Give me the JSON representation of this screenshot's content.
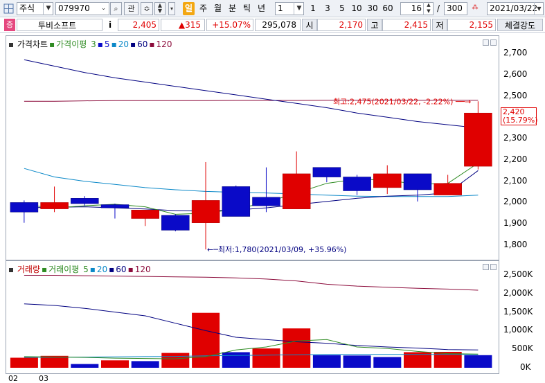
{
  "toolbar": {
    "market": "주식",
    "code": "079970",
    "buttons": [
      "관"
    ],
    "periods": [
      "일",
      "주",
      "월",
      "분",
      "틱",
      "년"
    ],
    "selected_period": "일",
    "interval": "1",
    "intervals": [
      "1",
      "3",
      "5",
      "10",
      "30",
      "60"
    ],
    "count": "16",
    "count_sep": "/",
    "total": "300",
    "date": "2021/03/22"
  },
  "quote": {
    "badge": "증",
    "name": "투비소프트",
    "info": "i",
    "price": "2,405",
    "change": "▲315",
    "change_pct": "+15.07%",
    "volume": "295,078",
    "open_label": "시",
    "open": "2,170",
    "high_label": "고",
    "high": "2,415",
    "low_label": "저",
    "low": "2,155",
    "strength": "체결강도"
  },
  "price_panel": {
    "legend": [
      {
        "text": "가격차트",
        "color": "#000000"
      },
      {
        "text": "가격이평",
        "color": "#2e8b22"
      },
      {
        "text": "3",
        "color": "#2e8b22"
      },
      {
        "text": "5",
        "color": "#0a0ac8"
      },
      {
        "text": "20",
        "color": "#0a88c8"
      },
      {
        "text": "60",
        "color": "#000080"
      },
      {
        "text": "120",
        "color": "#8b0a3a"
      }
    ],
    "high_annotation": "최고:2,475(2021/03/22, -2.22%)",
    "low_annotation": "최저:1,780(2021/03/09, +35.96%)",
    "current_price": "2,420",
    "current_pct": "(15.79%)",
    "yticks": [
      "2,700",
      "2,600",
      "2,500",
      "2,400",
      "2,300",
      "2,200",
      "2,100",
      "2,000",
      "1,900",
      "1,800"
    ]
  },
  "volume_panel": {
    "legend": [
      {
        "text": "거래량",
        "color": "#c00000"
      },
      {
        "text": "거래이평",
        "color": "#2e8b22"
      },
      {
        "text": "5",
        "color": "#2e8b22"
      },
      {
        "text": "20",
        "color": "#0a88c8"
      },
      {
        "text": "60",
        "color": "#000080"
      },
      {
        "text": "120",
        "color": "#8b0a3a"
      }
    ],
    "yticks": [
      "2,500K",
      "2,000K",
      "1,500K",
      "1,000K",
      "500K",
      "0K"
    ]
  },
  "xaxis": {
    "labels": [
      "02",
      "03"
    ]
  },
  "colors": {
    "up": "#e00000",
    "down": "#0a0ac8",
    "ma3": "#2e8b22",
    "ma20": "#0a88c8",
    "ma60": "#000080",
    "ma120": "#8b0a3a"
  },
  "chart_data": [
    {
      "type": "candlestick",
      "title": "가격차트",
      "ylim": [
        1720,
        2780
      ],
      "candles": [
        {
          "open": 2000,
          "high": 2010,
          "low": 1905,
          "close": 1955
        },
        {
          "open": 1970,
          "high": 2075,
          "low": 1955,
          "close": 2000
        },
        {
          "open": 2020,
          "high": 2030,
          "low": 1985,
          "close": 1995
        },
        {
          "open": 1990,
          "high": 1995,
          "low": 1925,
          "close": 1975
        },
        {
          "open": 1925,
          "high": 1965,
          "low": 1890,
          "close": 1965
        },
        {
          "open": 1940,
          "high": 1945,
          "low": 1865,
          "close": 1870
        },
        {
          "open": 1905,
          "high": 2190,
          "low": 1780,
          "close": 2010
        },
        {
          "open": 2075,
          "high": 2080,
          "low": 1935,
          "close": 1935
        },
        {
          "open": 2025,
          "high": 2165,
          "low": 1955,
          "close": 1985
        },
        {
          "open": 1970,
          "high": 2240,
          "low": 1970,
          "close": 2135
        },
        {
          "open": 2165,
          "high": 2165,
          "low": 2095,
          "close": 2120
        },
        {
          "open": 2120,
          "high": 2130,
          "low": 2035,
          "close": 2055
        },
        {
          "open": 2070,
          "high": 2175,
          "low": 2040,
          "close": 2135
        },
        {
          "open": 2135,
          "high": 2135,
          "low": 2005,
          "close": 2060
        },
        {
          "open": 2035,
          "high": 2130,
          "low": 2035,
          "close": 2090
        },
        {
          "open": 2170,
          "high": 2475,
          "low": 2155,
          "close": 2420
        }
      ],
      "ma": {
        "ma3": [
          1990,
          1975,
          1985,
          1992,
          1980,
          1945,
          1950,
          1970,
          2000,
          2045,
          2090,
          2110,
          2105,
          2085,
          2090,
          2185
        ],
        "ma20": [
          1975,
          1978,
          1980,
          1975,
          1970,
          1962,
          1960,
          1965,
          1975,
          1990,
          2005,
          2020,
          2030,
          2035,
          2045,
          2150
        ],
        "ma60": [
          2160,
          2120,
          2100,
          2085,
          2070,
          2060,
          2052,
          2048,
          2045,
          2040,
          2035,
          2030,
          2028,
          2028,
          2028,
          2035
        ],
        "ma120": [
          2670,
          2640,
          2610,
          2585,
          2565,
          2545,
          2525,
          2505,
          2485,
          2465,
          2445,
          2420,
          2400,
          2380,
          2365,
          2350
        ],
        "ma_flat": [
          2475,
          2475,
          2477,
          2478,
          2478,
          2478,
          2478,
          2479,
          2479,
          2479,
          2480,
          2480,
          2480,
          2480,
          2480,
          2480
        ]
      }
    },
    {
      "type": "bar",
      "title": "거래량",
      "ylim": [
        0,
        2600
      ],
      "values": [
        270,
        320,
        100,
        200,
        180,
        400,
        1480,
        420,
        520,
        1060,
        340,
        330,
        290,
        420,
        430,
        340
      ],
      "directions": [
        "up",
        "up",
        "down",
        "up",
        "down",
        "up",
        "up",
        "down",
        "up",
        "up",
        "down",
        "down",
        "down",
        "up",
        "up",
        "down"
      ],
      "ma": {
        "ma5": [
          300,
          290,
          280,
          260,
          250,
          240,
          300,
          480,
          560,
          720,
          760,
          560,
          520,
          440,
          380,
          370
        ],
        "ma20": [
          280,
          285,
          290,
          295,
          300,
          305,
          320,
          330,
          340,
          350,
          360,
          360,
          360,
          360,
          360,
          360
        ],
        "ma60": [
          1720,
          1680,
          1600,
          1500,
          1400,
          1200,
          1000,
          820,
          760,
          700,
          660,
          600,
          560,
          530,
          490,
          480
        ],
        "ma120": [
          2490,
          2490,
          2480,
          2470,
          2460,
          2450,
          2440,
          2420,
          2390,
          2340,
          2250,
          2200,
          2170,
          2140,
          2120,
          2090
        ]
      }
    }
  ]
}
